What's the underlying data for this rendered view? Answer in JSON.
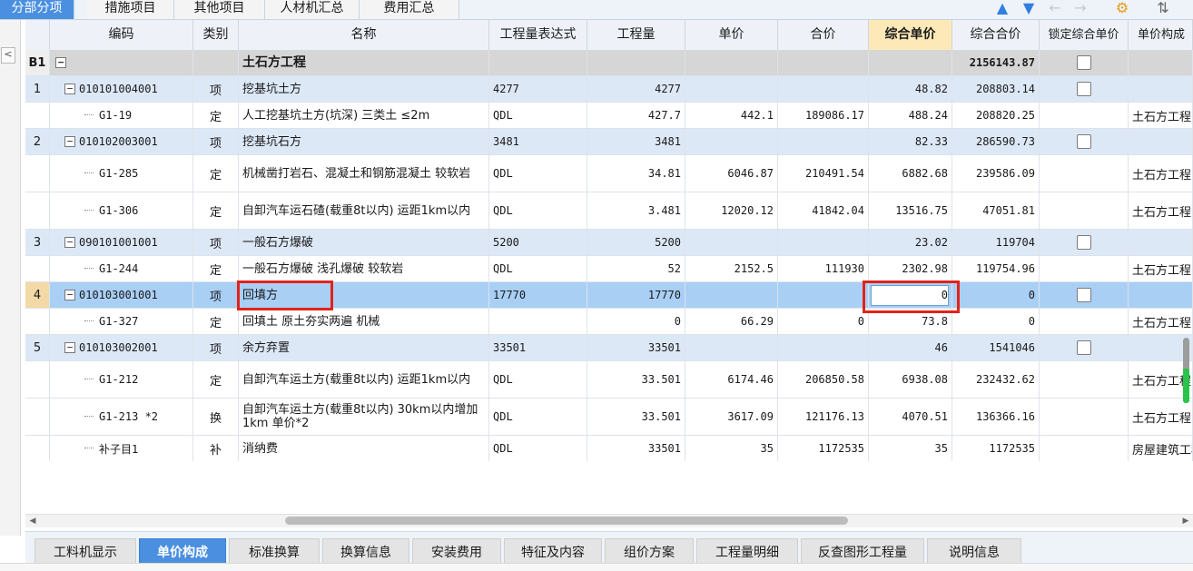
{
  "top_tabs": [
    {
      "label": "分部分项",
      "active": true
    },
    {
      "label": "措施项目",
      "active": false
    },
    {
      "label": "其他项目",
      "active": false
    },
    {
      "label": "人材机汇总",
      "active": false
    },
    {
      "label": "费用汇总",
      "active": false
    }
  ],
  "toolbar_icons": {
    "up": "▲",
    "down": "▼",
    "left": "←",
    "right": "→",
    "settings": "⚙",
    "sort": "⇅"
  },
  "collapse_label": "<",
  "columns": [
    "编码",
    "类别",
    "名称",
    "工程量表达式",
    "工程量",
    "单价",
    "合价",
    "综合单价",
    "综合合价",
    "锁定综合单价",
    "单价构成"
  ],
  "rows": [
    {
      "num": "B1",
      "code": "",
      "type": "",
      "name": "土石方工程",
      "expr": "",
      "qty": "",
      "price": "",
      "total": "",
      "unit_total": "",
      "sum_total": "2156143.87",
      "locked": false,
      "comp": "",
      "kind": "b1"
    },
    {
      "num": "1",
      "code": "010101004001",
      "type": "项",
      "name": "挖基坑土方",
      "expr": "4277",
      "qty": "4277",
      "price": "",
      "total": "",
      "unit_total": "48.82",
      "sum_total": "208803.14",
      "locked": false,
      "comp": "",
      "kind": "group"
    },
    {
      "num": "",
      "code": "G1-19",
      "type": "定",
      "name": "人工挖基坑土方(坑深) 三类土 ≤2m",
      "expr": "QDL",
      "qty": "427.7",
      "price": "442.1",
      "total": "189086.17",
      "unit_total": "488.24",
      "sum_total": "208820.25",
      "locked": null,
      "comp": "土石方工程",
      "kind": "plain"
    },
    {
      "num": "2",
      "code": "010102003001",
      "type": "项",
      "name": "挖基坑石方",
      "expr": "3481",
      "qty": "3481",
      "price": "",
      "total": "",
      "unit_total": "82.33",
      "sum_total": "286590.73",
      "locked": false,
      "comp": "",
      "kind": "group"
    },
    {
      "num": "",
      "code": "G1-285",
      "type": "定",
      "name": "机械凿打岩石、混凝土和钢筋混凝土 较软岩",
      "expr": "QDL",
      "qty": "34.81",
      "price": "6046.87",
      "total": "210491.54",
      "unit_total": "6882.68",
      "sum_total": "239586.09",
      "locked": null,
      "comp": "土石方工程",
      "kind": "plain"
    },
    {
      "num": "",
      "code": "G1-306",
      "type": "定",
      "name": "自卸汽车运石碴(载重8t以内) 运距1km以内",
      "expr": "QDL",
      "qty": "3.481",
      "price": "12020.12",
      "total": "41842.04",
      "unit_total": "13516.75",
      "sum_total": "47051.81",
      "locked": null,
      "comp": "土石方工程",
      "kind": "plain"
    },
    {
      "num": "3",
      "code": "090101001001",
      "type": "项",
      "name": "一般石方爆破",
      "expr": "5200",
      "qty": "5200",
      "price": "",
      "total": "",
      "unit_total": "23.02",
      "sum_total": "119704",
      "locked": false,
      "comp": "",
      "kind": "group"
    },
    {
      "num": "",
      "code": "G1-244",
      "type": "定",
      "name": "一般石方爆破 浅孔爆破 较软岩",
      "expr": "QDL",
      "qty": "52",
      "price": "2152.5",
      "total": "111930",
      "unit_total": "2302.98",
      "sum_total": "119754.96",
      "locked": null,
      "comp": "土石方工程",
      "kind": "plain"
    },
    {
      "num": "4",
      "code": "010103001001",
      "type": "项",
      "name": "回填方",
      "expr": "17770",
      "qty": "17770",
      "price": "",
      "total": "",
      "unit_total": "0",
      "sum_total": "0",
      "locked": false,
      "comp": "",
      "kind": "sel"
    },
    {
      "num": "",
      "code": "G1-327",
      "type": "定",
      "name": "回填土 原土夯实两遍 机械",
      "expr": "",
      "qty": "0",
      "price": "66.29",
      "total": "0",
      "unit_total": "73.8",
      "sum_total": "0",
      "locked": null,
      "comp": "土石方工程",
      "kind": "plain"
    },
    {
      "num": "5",
      "code": "010103002001",
      "type": "项",
      "name": "余方弃置",
      "expr": "33501",
      "qty": "33501",
      "price": "",
      "total": "",
      "unit_total": "46",
      "sum_total": "1541046",
      "locked": false,
      "comp": "",
      "kind": "group"
    },
    {
      "num": "",
      "code": "G1-212",
      "type": "定",
      "name": "自卸汽车运土方(载重8t以内) 运距1km以内",
      "expr": "QDL",
      "qty": "33.501",
      "price": "6174.46",
      "total": "206850.58",
      "unit_total": "6938.08",
      "sum_total": "232432.62",
      "locked": null,
      "comp": "土石方工程",
      "kind": "plain"
    },
    {
      "num": "",
      "code": "G1-213 *2",
      "type": "换",
      "name": "自卸汽车运土方(载重8t以内) 30km以内增加1km 单价*2",
      "expr": "QDL",
      "qty": "33.501",
      "price": "3617.09",
      "total": "121176.13",
      "unit_total": "4070.51",
      "sum_total": "136366.16",
      "locked": null,
      "comp": "土石方工程",
      "kind": "plain"
    },
    {
      "num": "",
      "code": "补子目1",
      "type": "补",
      "name": "消纳费",
      "expr": "QDL",
      "qty": "33501",
      "price": "35",
      "total": "1172535",
      "unit_total": "35",
      "sum_total": "1172535",
      "locked": null,
      "comp": "房屋建筑工程",
      "kind": "plain"
    }
  ],
  "bottom_tabs": [
    {
      "label": "工料机显示",
      "active": false
    },
    {
      "label": "单价构成",
      "active": true
    },
    {
      "label": "标准换算",
      "active": false
    },
    {
      "label": "换算信息",
      "active": false
    },
    {
      "label": "安装费用",
      "active": false
    },
    {
      "label": "特征及内容",
      "active": false
    },
    {
      "label": "组价方案",
      "active": false
    },
    {
      "label": "工程量明细",
      "active": false
    },
    {
      "label": "反查图形工程量",
      "active": false
    },
    {
      "label": "说明信息",
      "active": false
    }
  ]
}
